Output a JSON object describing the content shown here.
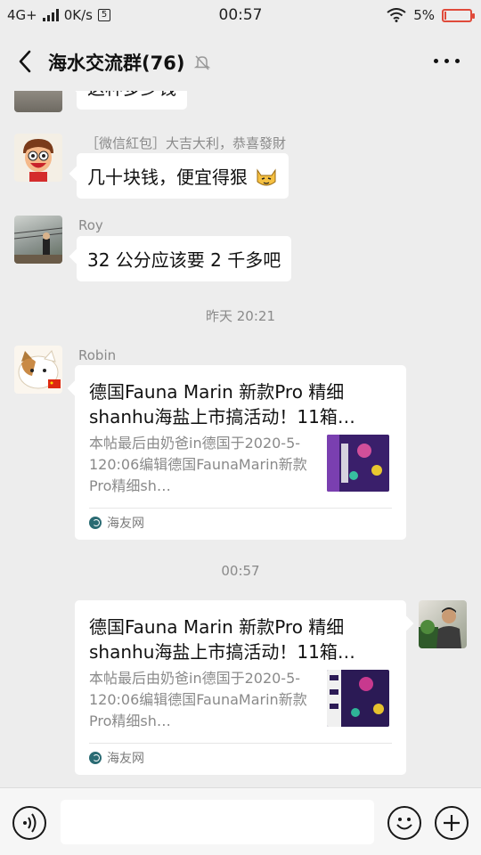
{
  "status_bar": {
    "network": "4G+",
    "speed": "0K/s",
    "speed_box": "5",
    "time": "00:57",
    "battery_pct": "5%",
    "battery_level": 0.05,
    "battery_color": "#e04a3a"
  },
  "header": {
    "title": "海水交流群(76)",
    "back_icon": "chevron-left-icon",
    "mute_icon": "bell-muted-icon",
    "more_icon": "more-dots-icon"
  },
  "messages": [
    {
      "type": "text",
      "text": "这种多少钱"
    },
    {
      "type": "text",
      "sender": "［微信紅包］大吉大利，恭喜發財",
      "text": "几十块钱，便宜得狠",
      "emoji": "cat-face"
    },
    {
      "type": "text",
      "sender": "Roy",
      "text": "32 公分应该要 2 千多吧"
    },
    {
      "type": "timestamp",
      "text": "昨天 20:21"
    },
    {
      "type": "card",
      "sender": "Robin",
      "title": "德国Fauna Marin 新款Pro 精细shanhu海盐上市搞活动！11箱…",
      "desc": "本帖最后由奶爸in德国于2020-5-120:06编辑德国FaunaMarin新款Pro精细sh…",
      "source": "海友网"
    },
    {
      "type": "timestamp",
      "text": "00:57"
    },
    {
      "type": "card",
      "side": "right",
      "title": "德国Fauna Marin 新款Pro 精细shanhu海盐上市搞活动！11箱…",
      "desc": "本帖最后由奶爸in德国于2020-5-120:06编辑德国FaunaMarin新款Pro精细sh…",
      "source": "海友网"
    }
  ],
  "input_bar": {
    "voice_icon": "voice-icon",
    "text_value": "",
    "emoji_icon": "emoji-icon",
    "plus_icon": "plus-icon"
  },
  "colors": {
    "background": "#ededed",
    "bubble": "#ffffff",
    "meta_text": "#8a8a8a",
    "link_icon": "#2a6b73"
  }
}
